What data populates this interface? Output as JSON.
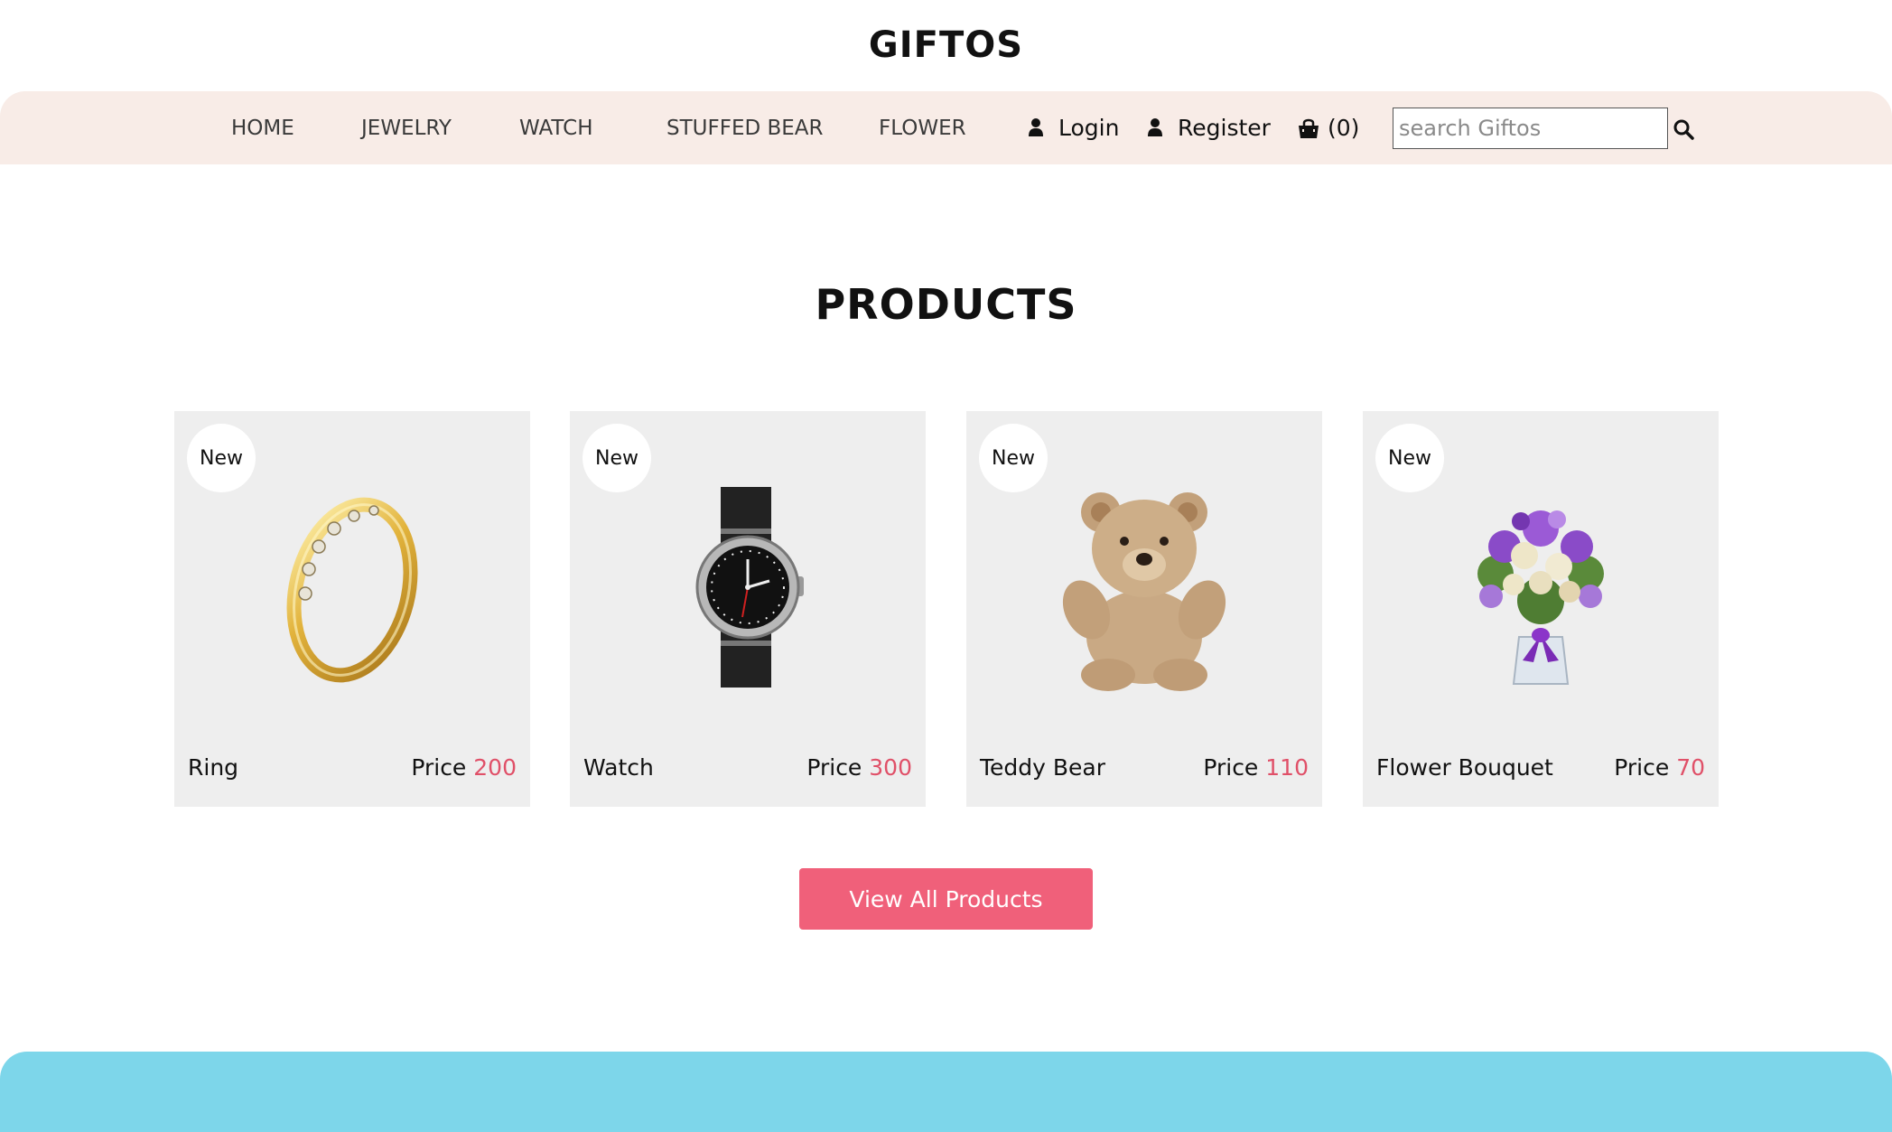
{
  "brand": {
    "name": "GIFTOS"
  },
  "nav": {
    "links": [
      "HOME",
      "JEWELRY",
      "WATCH",
      "STUFFED BEAR",
      "FLOWER"
    ],
    "login_label": "Login",
    "register_label": "Register",
    "cart_label": "(0)",
    "search_placeholder": "search Giftos"
  },
  "products": {
    "title": "PRODUCTS",
    "price_prefix": "Price",
    "items": [
      {
        "badge": "New",
        "name": "Ring",
        "price": "200",
        "icon": "ring-image"
      },
      {
        "badge": "New",
        "name": "Watch",
        "price": "300",
        "icon": "watch-image"
      },
      {
        "badge": "New",
        "name": "Teddy Bear",
        "price": "110",
        "icon": "teddy-bear-image"
      },
      {
        "badge": "New",
        "name": "Flower Bouquet",
        "price": "70",
        "icon": "flower-bouquet-image"
      }
    ],
    "view_all_label": "View All Products"
  },
  "colors": {
    "nav_background": "#f8ece7",
    "card_background": "#eeeeee",
    "price_accent": "#e05068",
    "button": "#f0607a",
    "footer": "#7dd6ea"
  }
}
